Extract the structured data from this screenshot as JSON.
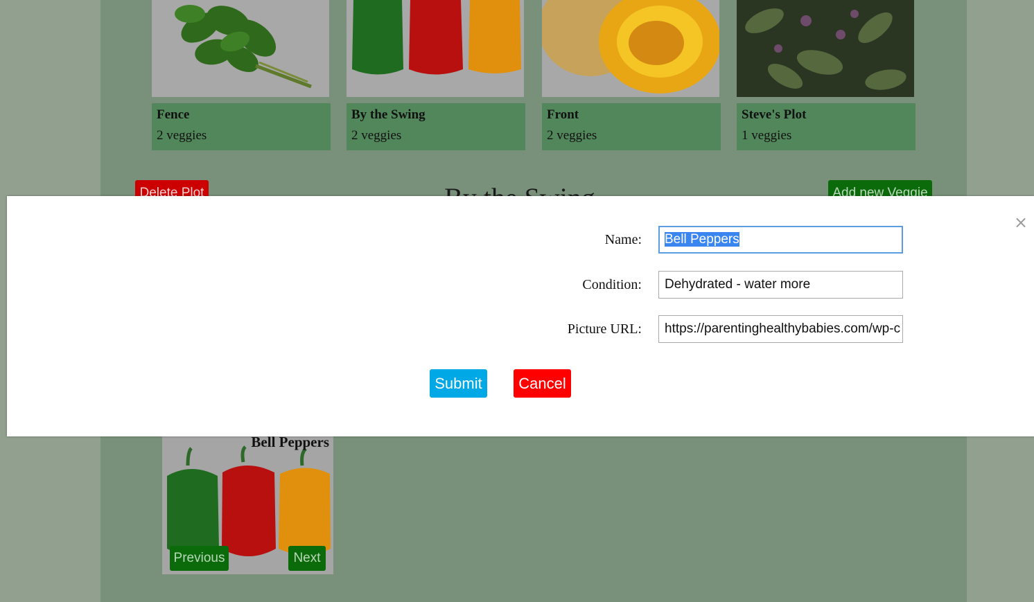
{
  "plots": [
    {
      "name": "Fence",
      "count": "2 veggies",
      "image_icon": "basil-photo"
    },
    {
      "name": "By the Swing",
      "count": "2 veggies",
      "image_icon": "bell-peppers-photo"
    },
    {
      "name": "Front",
      "count": "2 veggies",
      "image_icon": "squash-photo"
    },
    {
      "name": "Steve's Plot",
      "count": "1 veggies",
      "image_icon": "purple-basil-photo"
    }
  ],
  "plot_actions": {
    "delete_label": "Delete Plot",
    "add_veggie_label": "Add new Veggie",
    "title": "By the Swing"
  },
  "veggie_card": {
    "name": "Bell Peppers",
    "previous_label": "Previous",
    "next_label": "Next"
  },
  "modal": {
    "close_icon": "×",
    "fields": {
      "name_label": "Name:",
      "name_value": "Bell Peppers",
      "condition_label": "Condition:",
      "condition_value": "Dehydrated - water more",
      "picture_label": "Picture URL:",
      "picture_value": "https://parentinghealthybabies.com/wp-c"
    },
    "submit_label": "Submit",
    "cancel_label": "Cancel"
  },
  "colors": {
    "overlay_backdrop": "#91a08f",
    "plot_info_green": "#51875a",
    "submit_blue": "#00a8e6",
    "cancel_red": "#ff0000",
    "nav_green": "#0b6b0b"
  }
}
